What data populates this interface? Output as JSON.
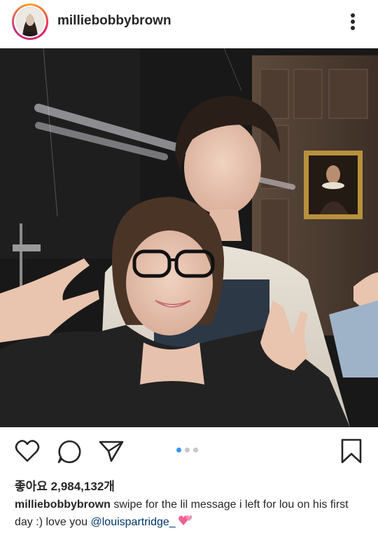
{
  "post": {
    "username": "milliebobbybrown",
    "likes_text": "좋아요 2,984,132개",
    "caption": {
      "username": "milliebobbybrown",
      "text": " swipe for the lil message i left for lou on his first day :) love you ",
      "mention": "@louispartridge_",
      "emoji_icon": "two-hearts-icon"
    },
    "carousel": {
      "total": 3,
      "current": 1
    }
  },
  "icons": {
    "more": "more-vertical-icon",
    "like": "heart-outline-icon",
    "comment": "comment-bubble-icon",
    "share": "paper-plane-icon",
    "save": "bookmark-icon"
  },
  "colors": {
    "text": "#262626",
    "accent": "#3897f0",
    "mention": "#003569",
    "dot_inactive": "#c7c7c7",
    "heart_emoji": "#f06292"
  }
}
